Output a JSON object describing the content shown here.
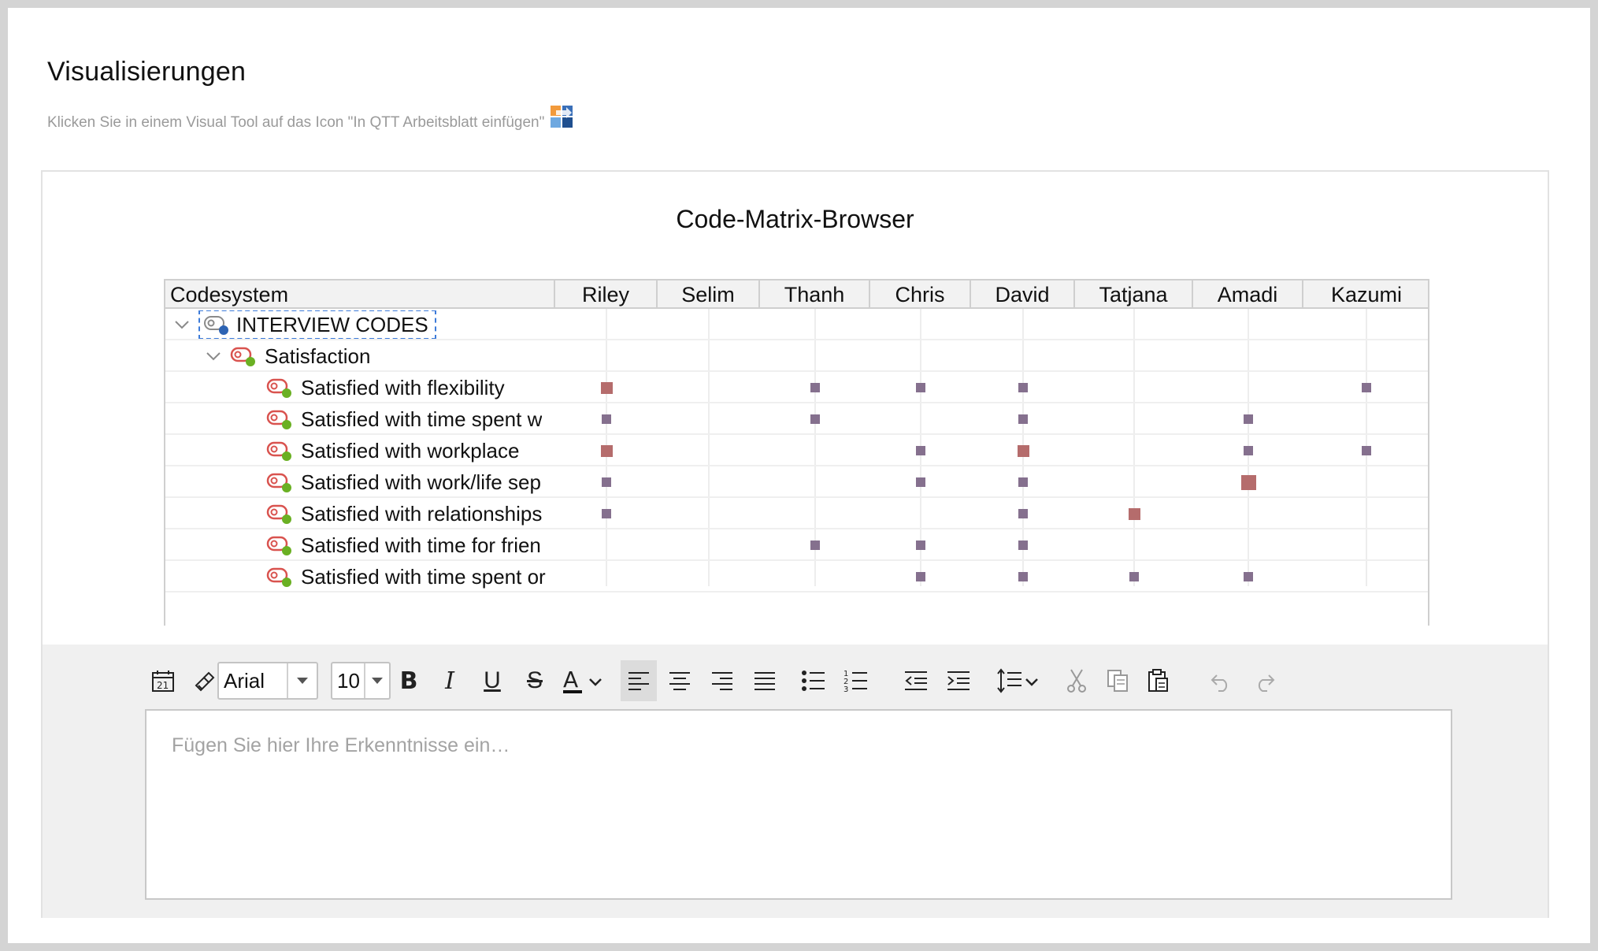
{
  "page": {
    "title": "Visualisierungen",
    "hint": "Klicken Sie in einem Visual Tool auf das Icon \"In QTT Arbeitsblatt einfügen\"",
    "hint_icon": "insert-into-worksheet-icon"
  },
  "panel": {
    "title": "Code-Matrix-Browser"
  },
  "matrix": {
    "header_codesystem": "Codesystem",
    "columns": [
      "Riley",
      "Selim",
      "Thanh",
      "Chris",
      "David",
      "Tatjana",
      "Amadi",
      "Kazumi"
    ],
    "root": {
      "label": "INTERVIEW CODES",
      "expanded": true,
      "icon": "code-group-blue-icon"
    },
    "parent": {
      "label": "Satisfaction",
      "expanded": true,
      "icon": "code-red-green-icon"
    },
    "rows": [
      {
        "label": "Satisfied with flexibility",
        "cells": [
          2,
          0,
          1,
          1,
          1,
          0,
          0,
          1
        ]
      },
      {
        "label": "Satisfied with time spent w",
        "cells": [
          1,
          0,
          1,
          0,
          1,
          0,
          1,
          0
        ]
      },
      {
        "label": "Satisfied with workplace",
        "cells": [
          2,
          0,
          0,
          1,
          2,
          0,
          1,
          1
        ]
      },
      {
        "label": "Satisfied with work/life sep",
        "cells": [
          1,
          0,
          0,
          1,
          1,
          0,
          3,
          0
        ]
      },
      {
        "label": "Satisfied with relationships",
        "cells": [
          1,
          0,
          0,
          0,
          1,
          2,
          0,
          0
        ]
      },
      {
        "label": "Satisfied with time for frien",
        "cells": [
          0,
          0,
          1,
          1,
          1,
          0,
          0,
          0
        ]
      },
      {
        "label": "Satisfied with time spent or",
        "cells": [
          0,
          0,
          0,
          1,
          1,
          1,
          1,
          0
        ]
      }
    ],
    "colors": {
      "small": "#85708e",
      "large": "#b56c6c"
    }
  },
  "editor": {
    "font": "Arial",
    "size": "10",
    "placeholder": "Fügen Sie hier Ihre Erkenntnisse ein…",
    "tools": [
      "date-icon",
      "format-painter-icon",
      "bold-icon",
      "italic-icon",
      "underline-icon",
      "strikethrough-icon",
      "font-color-icon",
      "align-left-icon",
      "align-center-icon",
      "align-right-icon",
      "justify-icon",
      "bullet-list-icon",
      "numbered-list-icon",
      "outdent-icon",
      "indent-icon",
      "line-spacing-icon",
      "cut-icon",
      "copy-icon",
      "paste-icon",
      "undo-icon",
      "redo-icon"
    ]
  }
}
